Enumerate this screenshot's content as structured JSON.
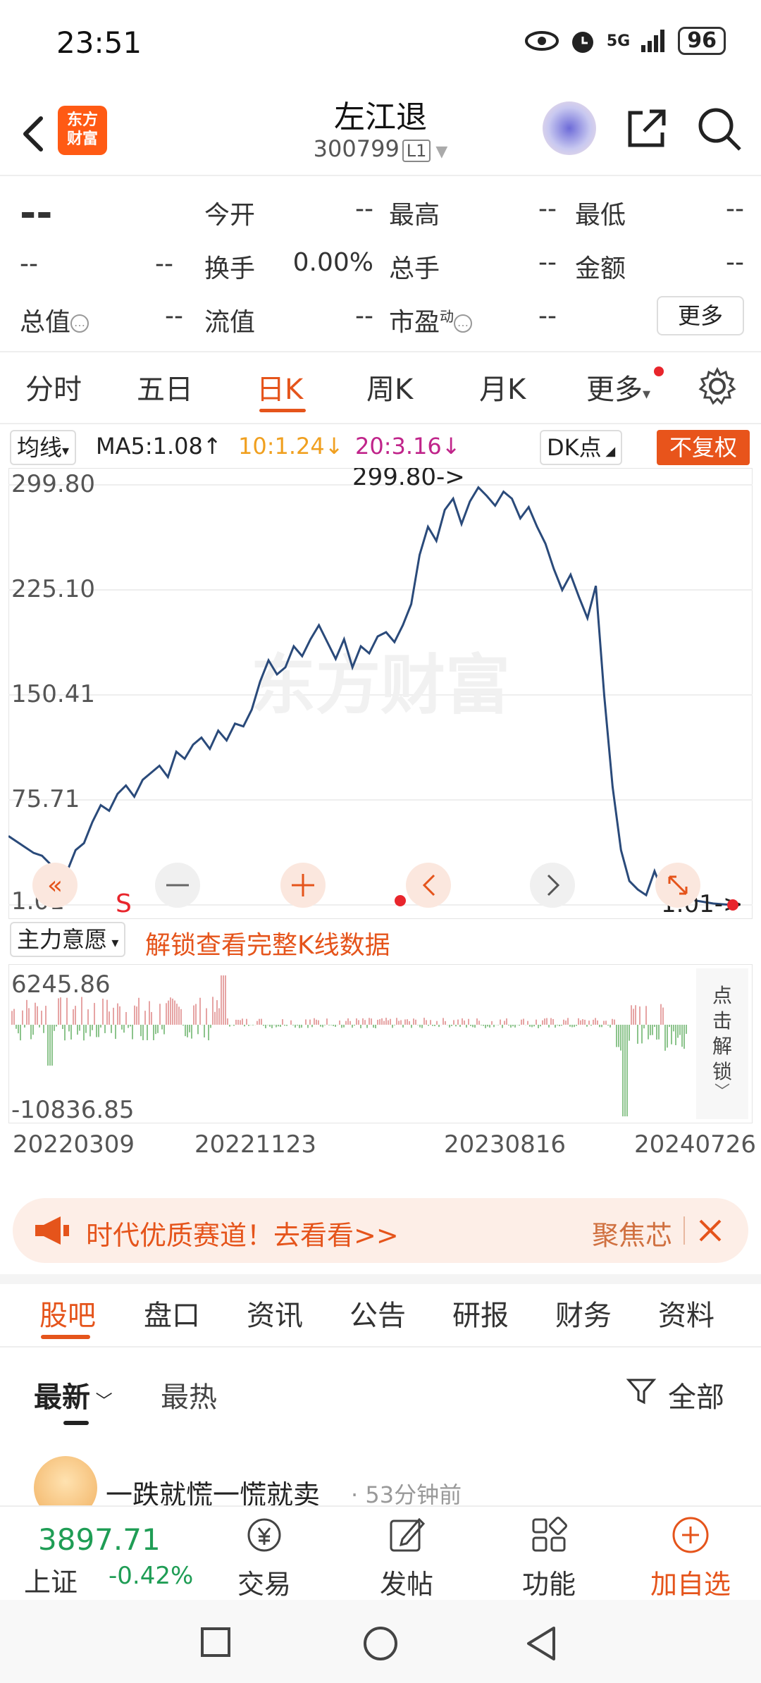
{
  "status": {
    "time": "23:51",
    "battery": "96",
    "signal": "5G"
  },
  "header": {
    "title": "左江退",
    "code": "300799",
    "level": "L1",
    "logo_line1": "东方",
    "logo_line2": "财富"
  },
  "quote": {
    "price": "--",
    "change": "--",
    "change_pct": "--",
    "rows": [
      [
        {
          "label": "今开",
          "value": "--"
        },
        {
          "label": "最高",
          "value": "--"
        },
        {
          "label": "最低",
          "value": "--"
        }
      ],
      [
        {
          "label": "换手",
          "value": "0.00%"
        },
        {
          "label": "总手",
          "value": "--"
        },
        {
          "label": "金额",
          "value": "--"
        }
      ],
      [
        {
          "label": "流值",
          "value": "--"
        },
        {
          "label": "市盈",
          "value": "--"
        }
      ]
    ],
    "total_value_label": "总值",
    "total_value": "--",
    "pe_sup": "动",
    "more_label": "更多"
  },
  "tabs": [
    "分时",
    "五日",
    "日K",
    "周K",
    "月K",
    "更多"
  ],
  "chart_header": {
    "indicator": "均线",
    "ma5": "MA5:1.08",
    "ma10": "10:1.24",
    "ma20": "20:3.16",
    "dk": "DK点",
    "fq": "不复权",
    "watermark": "东方财富"
  },
  "chart_data": {
    "type": "line",
    "y_ticks": [
      "299.80",
      "225.10",
      "150.41",
      "75.71",
      "1.01"
    ],
    "ylim": [
      1.01,
      299.8
    ],
    "max_label": "299.80->",
    "min_label": "1.01->",
    "s_marker": "S",
    "values": [
      50,
      46,
      42,
      38,
      36,
      30,
      28,
      25,
      40,
      45,
      60,
      72,
      68,
      80,
      86,
      78,
      90,
      95,
      100,
      92,
      110,
      105,
      115,
      120,
      112,
      125,
      118,
      130,
      128,
      140,
      160,
      175,
      165,
      170,
      185,
      178,
      190,
      200,
      188,
      176,
      190,
      170,
      185,
      180,
      192,
      195,
      188,
      200,
      215,
      250,
      270,
      260,
      282,
      290,
      272,
      288,
      298,
      292,
      285,
      295,
      290,
      276,
      284,
      270,
      258,
      240,
      225,
      236,
      220,
      205,
      228,
      150,
      85,
      40,
      18,
      12,
      8,
      25,
      10,
      8,
      5,
      6,
      4,
      3,
      2,
      1.5,
      1.1,
      1.01
    ],
    "xlabels": [
      "20220309",
      "20221123",
      "20230816",
      "20240726"
    ],
    "flow": {
      "indicator": "主力意愿",
      "unlock_text": "解锁查看完整K线数据",
      "y_top": "6245.86",
      "y_bottom": "-10836.85",
      "side_text": [
        "点",
        "击",
        "解",
        "锁"
      ]
    }
  },
  "promo": {
    "text": "时代优质赛道！去看看>>",
    "right": "聚焦芯"
  },
  "sections": [
    "股吧",
    "盘口",
    "资讯",
    "公告",
    "研报",
    "财务",
    "资料"
  ],
  "feed": {
    "sort_new": "最新",
    "sort_hot": "最热",
    "filter": "全部",
    "first_post": {
      "title": "一跌就慌一慌就卖",
      "time": "53分钟前"
    }
  },
  "bottom_nav": {
    "index_value": "3897.71",
    "index_name": "上证",
    "index_change": "-0.42%",
    "trade": "交易",
    "post": "发帖",
    "func": "功能",
    "add": "加自选"
  },
  "colors": {
    "accent": "#e5541b",
    "down": "#1f9d55",
    "up": "#e8252c",
    "line": "#2a4a7a"
  }
}
